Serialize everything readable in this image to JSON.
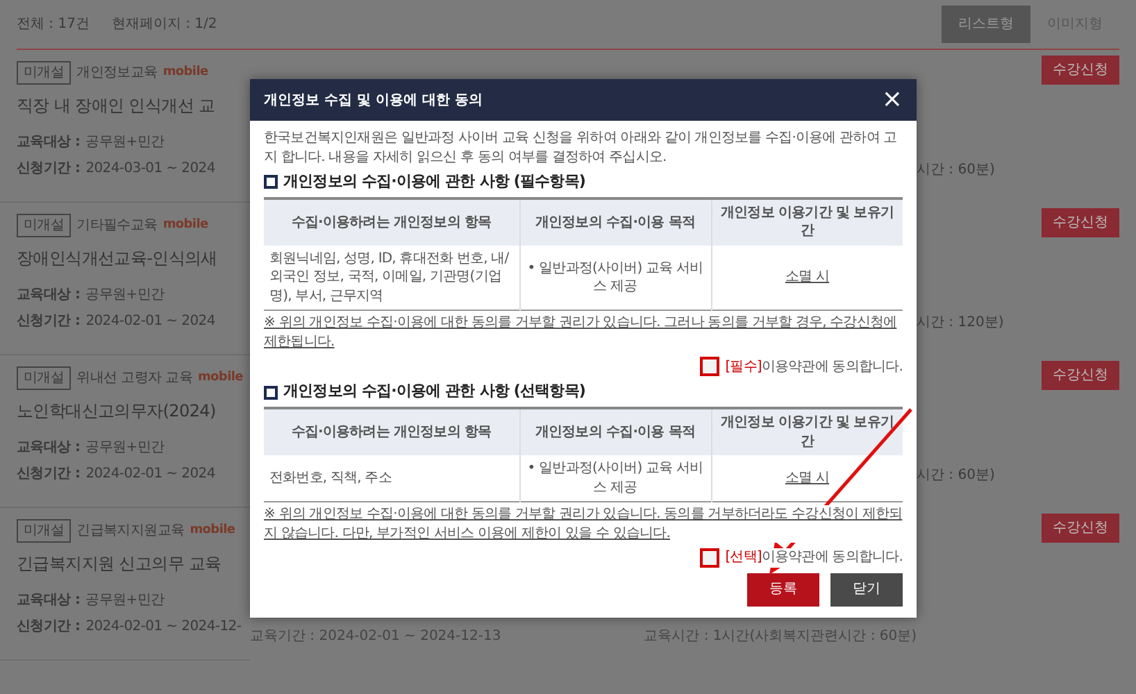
{
  "summary": {
    "total": "전체 : 17건",
    "page": "현재페이지 : 1/2"
  },
  "view_buttons": [
    {
      "label": "리스트형",
      "selected": true
    },
    {
      "label": "이미지형",
      "selected": false
    }
  ],
  "courses": [
    {
      "status": "미개설",
      "category": "개인정보교육",
      "tags": [
        "mobile"
      ],
      "title": "직장 내 장애인 인식개선 교",
      "target_label": "교육대상 :",
      "target": "공무원+민간",
      "period_label": "신청기간 :",
      "period": "2024-03-01 ~ 2024",
      "time": "시간 : 60분)",
      "apply": "수강신청"
    },
    {
      "status": "미개설",
      "category": "기타필수교육",
      "tags": [
        "mobile"
      ],
      "title": "장애인식개선교육-인식의새",
      "target_label": "교육대상 :",
      "target": "공무원+민간",
      "period_label": "신청기간 :",
      "period": "2024-02-01 ~ 2024",
      "time": "시간 : 120분)",
      "apply": "수강신청"
    },
    {
      "status": "미개설",
      "category": "위내선 고령자 교육",
      "tags": [
        "mobile"
      ],
      "title": "노인학대신고의무자(2024)",
      "target_label": "교육대상 :",
      "target": "공무원+민간",
      "period_label": "신청기간 :",
      "period": "2024-02-01 ~ 2024",
      "time": "시간 : 60분)",
      "apply": "수강신청"
    },
    {
      "status": "미개설",
      "category": "긴급복지지원교육",
      "tags": [
        "mobile"
      ],
      "title": "긴급복지지원 신고의무 교육",
      "target_label": "교육대상 :",
      "target": "공무원+민간",
      "period_label": "신청기간 :",
      "period": "2024-02-01 ~ 2024-12-",
      "time": "교육시간 : 1시간(사회복지관련시간 : 60분)",
      "apply": "수강신청",
      "course_period": "교육기간 : 2024-02-01 ~ 2024-12-13"
    }
  ],
  "modal": {
    "title": "개인정보 수집 및 이용에 대한 동의",
    "close": "×",
    "intro": "한국보건복지인재원은 일반과정 사이버 교육 신청을 위하여 아래와 같이 개인정보를 수집·이용에 관하여 고지 합니다. 내용을 자세히 읽으신 후 동의 여부를 결정하여 주십시오.",
    "sections": [
      {
        "heading": "개인정보의 수집·이용에 관한 사항 (필수항목)",
        "columns": [
          "수집·이용하려는 개인정보의 항목",
          "개인정보의 수집·이용 목적",
          "개인정보 이용기간 및 보유기간"
        ],
        "row": [
          "회원닉네임, 성명, ID, 휴대전화 번호, 내/외국인 정보, 국적, 이메일, 기관명(기업명), 부서, 근무지역",
          "• 일반과정(사이버) 교육 서비스 제공",
          "소멸 시"
        ],
        "note": "※ 위의 개인정보 수집·이용에 대한 동의를 거부할 권리가 있습니다. 그러나 동의를 거부할 경우, 수강신청에 제한됩니다.",
        "consent_tag": "[필수]",
        "consent": "이용약관에 동의합니다.",
        "checked": false,
        "highlighted": true
      },
      {
        "heading": "개인정보의 수집·이용에 관한 사항 (선택항목)",
        "columns": [
          "수집·이용하려는 개인정보의 항목",
          "개인정보의 수집·이용 목적",
          "개인정보 이용기간 및 보유기간"
        ],
        "row": [
          "전화번호, 직책, 주소",
          "• 일반과정(사이버) 교육 서비스 제공",
          "소멸 시"
        ],
        "note": "※ 위의 개인정보 수집·이용에 대한 동의를 거부할 권리가 있습니다. 동의를 거부하더라도 수강신청이 제한되지 않습니다. 다만, 부가적인 서비스 이용에 제한이 있을 수 있습니다.",
        "consent_tag": "[선택]",
        "consent": "이용약관에 동의합니다.",
        "checked": false,
        "highlighted": true
      }
    ],
    "buttons": [
      {
        "label": "등록",
        "kind": "primary"
      },
      {
        "label": "닫기",
        "kind": "secondary"
      }
    ]
  }
}
